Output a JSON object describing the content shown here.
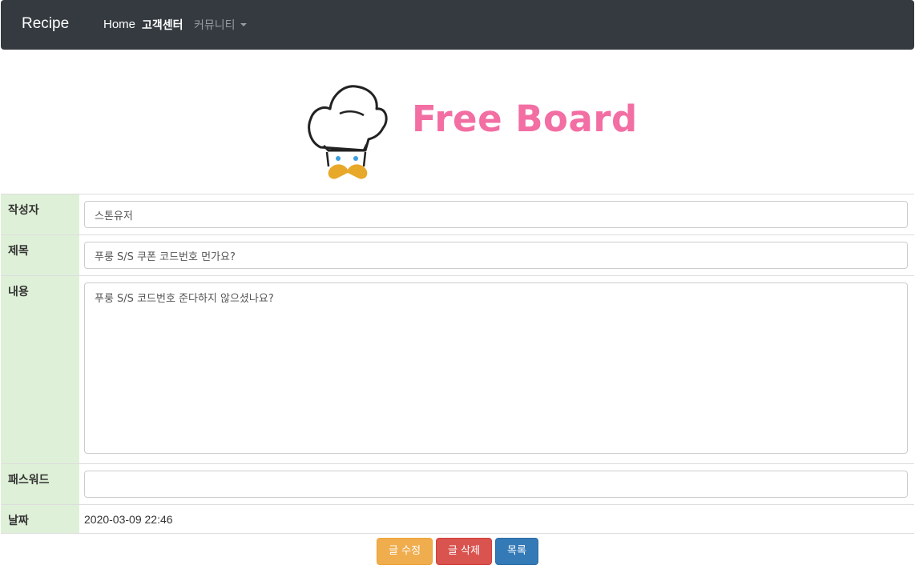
{
  "navbar": {
    "brand": "Recipe",
    "links": [
      {
        "label": "Home"
      },
      {
        "label": "고객센터"
      },
      {
        "label": "커뮤니티"
      }
    ]
  },
  "logo": {
    "text": "Free Board"
  },
  "form": {
    "writer": {
      "label": "작성자",
      "value": "스톤유저"
    },
    "title": {
      "label": "제목",
      "value": "푸룽 S/S 쿠폰 코드번호 먼가요?"
    },
    "content": {
      "label": "내용",
      "value": "푸룽 S/S 코드번호 준다하지 않으셨나요?"
    },
    "password": {
      "label": "패스워드",
      "value": ""
    },
    "date": {
      "label": "날짜",
      "value": "2020-03-09 22:46"
    }
  },
  "buttons": {
    "edit": "글 수정",
    "delete": "글 삭제",
    "list": "목록"
  },
  "colors": {
    "navbar": "#343a40",
    "label_bg": "#dff0d8",
    "logo_pink": "#f26ea3",
    "btn_edit": "#f0ad4e",
    "btn_delete": "#d9534f",
    "btn_list": "#337ab7"
  }
}
